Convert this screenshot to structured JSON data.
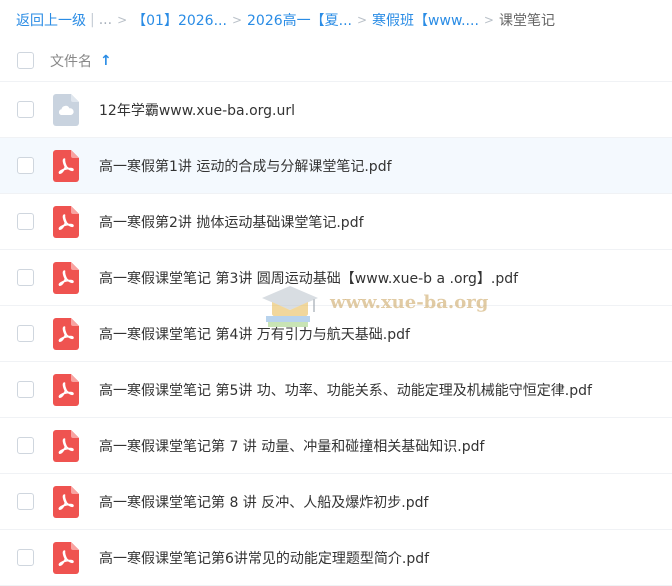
{
  "breadcrumb": {
    "back_label": "返回上一级",
    "ellipsis": "...",
    "items": [
      {
        "label": "【01】2026..."
      },
      {
        "label": "2026高一【夏..."
      },
      {
        "label": "寒假班【www...."
      }
    ],
    "current": "课堂笔记"
  },
  "header": {
    "column_title": "文件名",
    "sort_direction": "ascending",
    "sort_icon": "arrow-up-icon"
  },
  "files": [
    {
      "name": "12年学霸www.xue-ba.org.url",
      "icon": "link-file-icon",
      "type": "url"
    },
    {
      "name": "高一寒假第1讲 运动的合成与分解课堂笔记.pdf",
      "icon": "pdf-icon",
      "type": "pdf"
    },
    {
      "name": "高一寒假第2讲 抛体运动基础课堂笔记.pdf",
      "icon": "pdf-icon",
      "type": "pdf"
    },
    {
      "name": "高一寒假课堂笔记 第3讲 圆周运动基础【www.xue-b a .org】.pdf",
      "icon": "pdf-icon",
      "type": "pdf"
    },
    {
      "name": "高一寒假课堂笔记 第4讲 万有引力与航天基础.pdf",
      "icon": "pdf-icon",
      "type": "pdf"
    },
    {
      "name": "高一寒假课堂笔记 第5讲 功、功率、功能关系、动能定理及机械能守恒定律.pdf",
      "icon": "pdf-icon",
      "type": "pdf"
    },
    {
      "name": "高一寒假课堂笔记第 7 讲 动量、冲量和碰撞相关基础知识.pdf",
      "icon": "pdf-icon",
      "type": "pdf"
    },
    {
      "name": "高一寒假课堂笔记第 8 讲 反冲、人船及爆炸初步.pdf",
      "icon": "pdf-icon",
      "type": "pdf"
    },
    {
      "name": "高一寒假课堂笔记第6讲常见的动能定理题型简介.pdf",
      "icon": "pdf-icon",
      "type": "pdf"
    }
  ],
  "watermark": {
    "text": "www.xue-ba.org"
  },
  "colors": {
    "link": "#2a8ce5",
    "pdf_red": "#ef5350",
    "url_gray": "#c9d3df",
    "row_hover": "#f4f9fe"
  }
}
